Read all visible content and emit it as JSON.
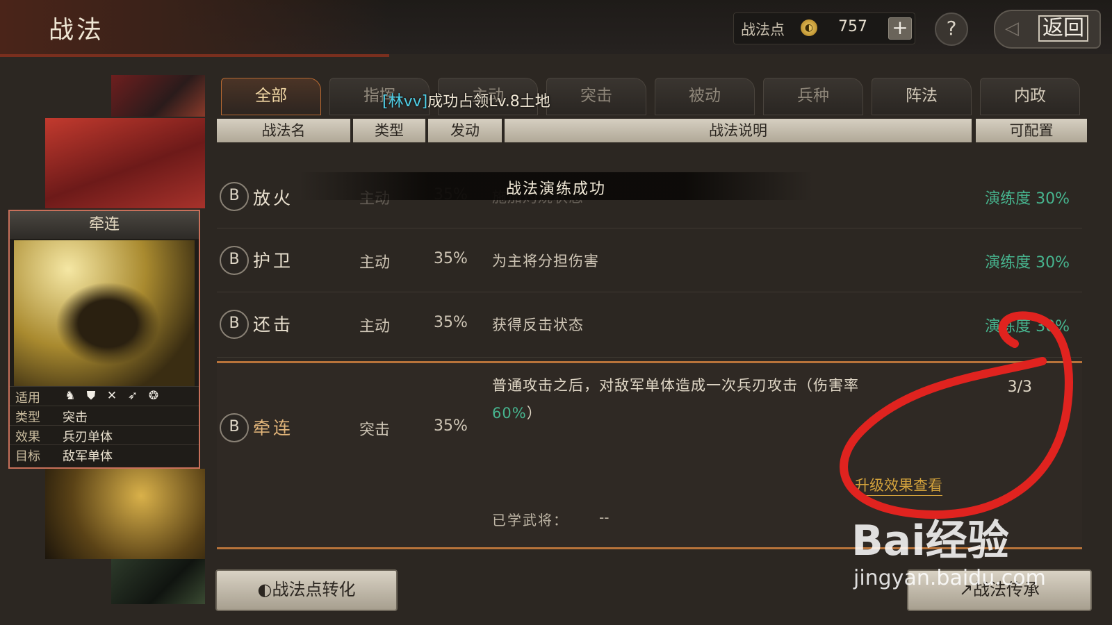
{
  "header": {
    "title": "战法",
    "points_label": "战法点",
    "points_value": "757",
    "plus": "+",
    "help": "?",
    "back": "返回"
  },
  "card": {
    "name": "牵连",
    "rows": [
      {
        "key": "适用",
        "value": ""
      },
      {
        "key": "类型",
        "value": "突击"
      },
      {
        "key": "效果",
        "value": "兵刃单体"
      },
      {
        "key": "目标",
        "value": "敌军单体"
      }
    ],
    "unit_icons": [
      "cavalry-icon",
      "shield-icon",
      "crossed-spears-icon",
      "archer-icon",
      "siege-wheel-icon"
    ]
  },
  "tabs": [
    "全部",
    "指挥",
    "主动",
    "突击",
    "被动",
    "兵种",
    "阵法",
    "内政"
  ],
  "notification": {
    "tag": "[林vv]",
    "text": "成功占领Lv.8土地"
  },
  "columns": [
    "战法名",
    "类型",
    "发动",
    "战法说明",
    "可配置"
  ],
  "toast": "战法演练成功",
  "rows": [
    {
      "grade": "B",
      "name": "放火",
      "type": "主动",
      "rate": "35%",
      "desc": "施加灼烧状态",
      "progress": "演练度 30%"
    },
    {
      "grade": "B",
      "name": "护卫",
      "type": "主动",
      "rate": "35%",
      "desc": "为主将分担伤害",
      "progress": "演练度 30%"
    },
    {
      "grade": "B",
      "name": "还击",
      "type": "主动",
      "rate": "35%",
      "desc": "获得反击状态",
      "progress": "演练度 30%"
    }
  ],
  "selected": {
    "grade": "B",
    "name": "牵连",
    "type": "突击",
    "rate": "35%",
    "desc_line1": "普通攻击之后，对敌军单体造成一次兵刃攻击（伤害率",
    "desc_hl": "60%",
    "desc_end": "）",
    "slots": "3/3",
    "upgrade_link": "升级效果查看",
    "learned_label": "已学武将：",
    "learned_value": "--"
  },
  "buttons": {
    "convert": "战法点转化",
    "transfer": "战法传承"
  },
  "watermark": {
    "brand": "Bai经验",
    "url": "jingyan.baidu.com"
  },
  "colors": {
    "accent": "#b8733a",
    "progress": "#47b58f",
    "highlight_tab": "#f3d9a6"
  }
}
